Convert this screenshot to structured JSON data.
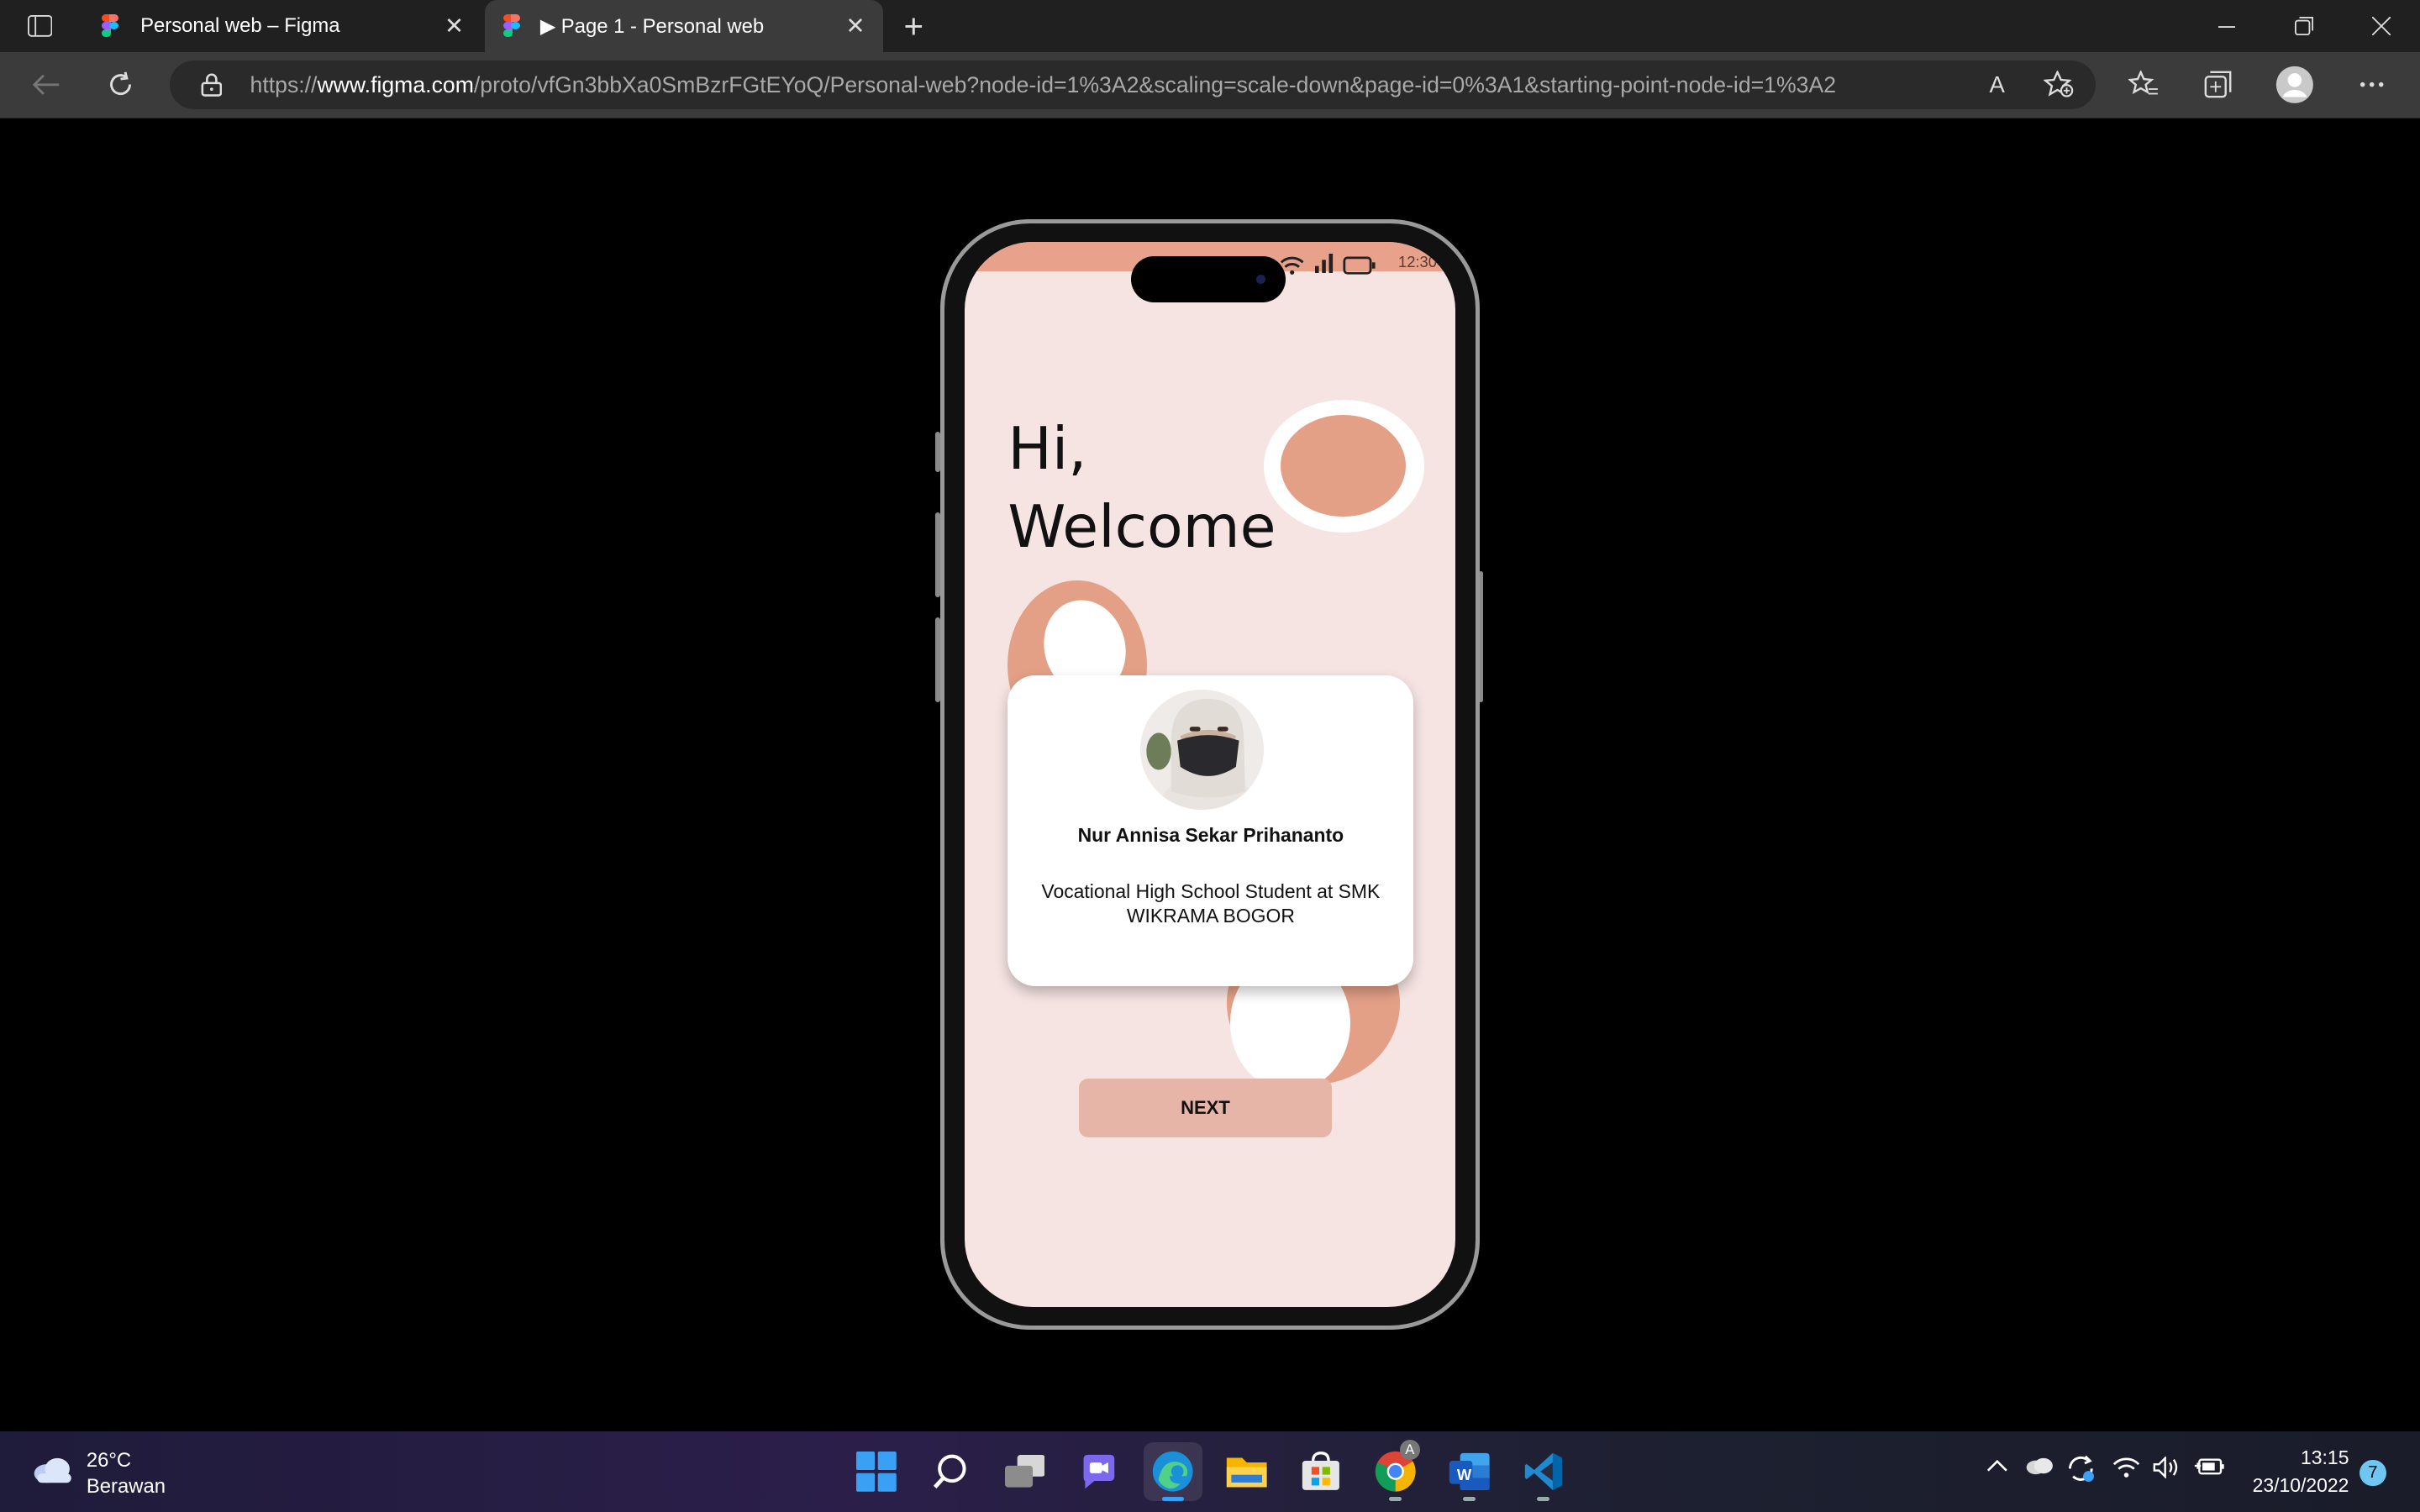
{
  "browser": {
    "tabs": [
      {
        "label": "Personal web – Figma",
        "active": false
      },
      {
        "label": "▶ Page 1 - Personal web",
        "active": true
      }
    ],
    "close_glyph": "✕",
    "new_tab_glyph": "+",
    "url_prefix": "https://",
    "url_host": "www.figma.com",
    "url_path": "/proto/vfGn3bbXa0SmBzrFGtEYoQ/Personal-web?node-id=1%3A2&scaling=scale-down&page-id=0%3A1&starting-point-node-id=1%3A2",
    "read_aloud_glyph": "A",
    "icons": [
      "sidebar-icon",
      "back-icon",
      "refresh-icon",
      "lock-icon",
      "read-aloud-icon",
      "add-favorite-icon",
      "favorites-icon",
      "collections-icon",
      "profile-icon",
      "more-icon"
    ]
  },
  "prototype": {
    "status_time": "12:30",
    "greeting_line1": "Hi,",
    "greeting_line2": "Welcome",
    "profile_name": "Nur Annisa Sekar Prihananto",
    "profile_role": "Vocational High School Student at SMK WIKRAMA BOGOR",
    "next_button": "NEXT",
    "colors": {
      "accent": "#e3a086",
      "background": "#f6e4e3",
      "button": "#e6b5a8",
      "card": "#ffffff"
    }
  },
  "taskbar": {
    "temperature": "26°C",
    "weather": "Berawan",
    "time": "13:15",
    "date": "23/10/2022",
    "notification_count": "7",
    "chrome_badge": "A",
    "word_letter": "W",
    "apps": [
      "start",
      "search",
      "task-view",
      "chat",
      "edge",
      "file-explorer",
      "store",
      "chrome",
      "word",
      "vscode"
    ]
  }
}
